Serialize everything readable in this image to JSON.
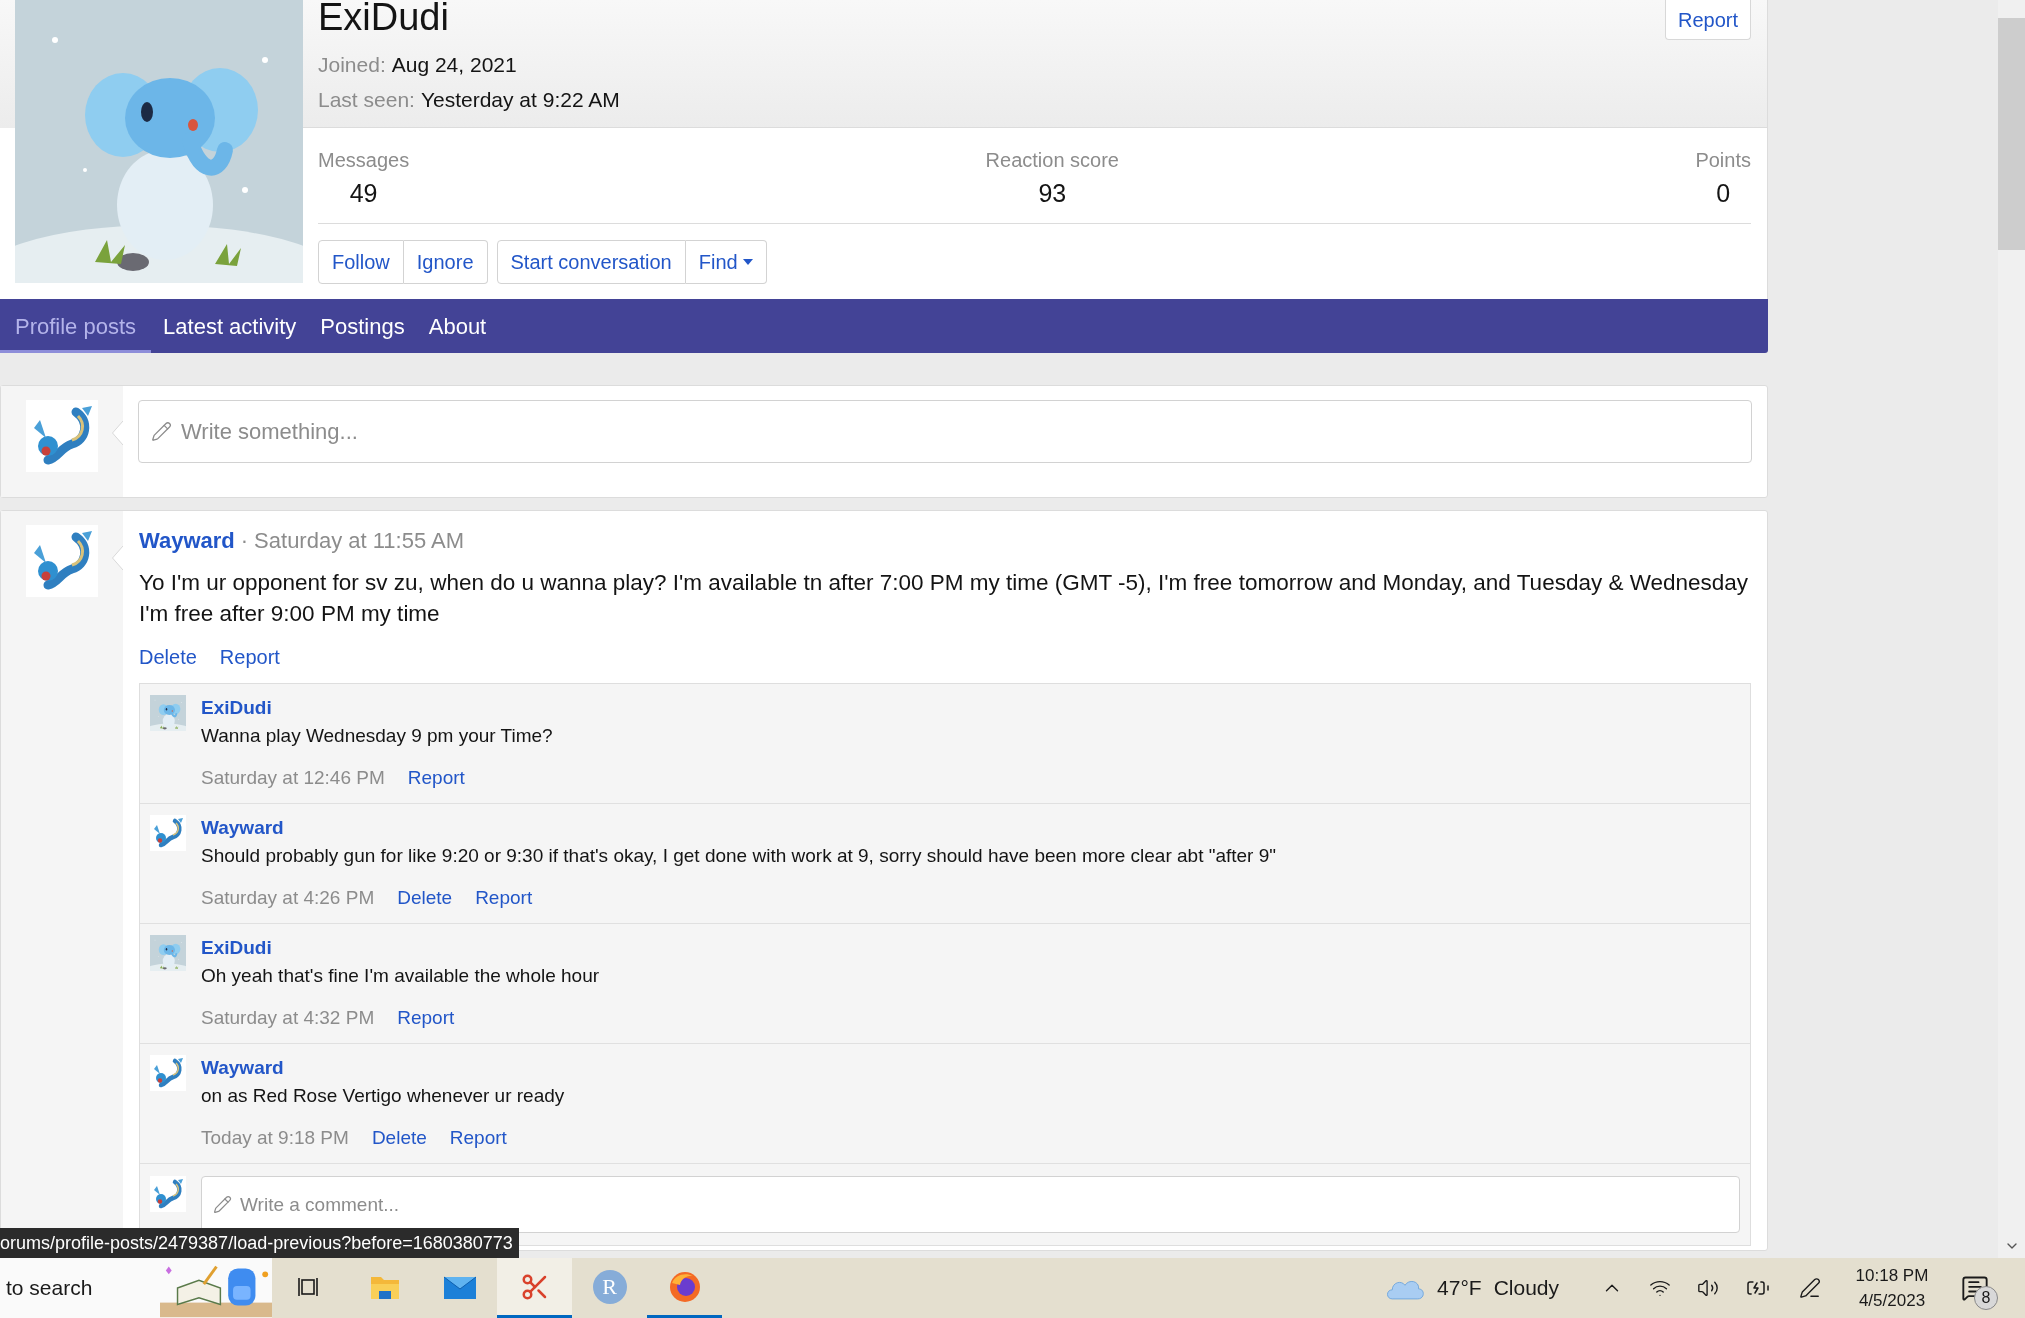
{
  "profile": {
    "name": "ExiDudi",
    "report": "Report",
    "details": [
      {
        "label": "Joined:",
        "value": "Aug 24, 2021"
      },
      {
        "label": "Last seen:",
        "value": "Yesterday at 9:22 AM"
      }
    ]
  },
  "stats": [
    {
      "label": "Messages",
      "value": "49"
    },
    {
      "label": "Reaction score",
      "value": "93"
    },
    {
      "label": "Points",
      "value": "0"
    }
  ],
  "action_groups": [
    [
      {
        "label": "Follow",
        "kind": "button"
      },
      {
        "label": "Ignore",
        "kind": "button"
      }
    ],
    [
      {
        "label": "Start conversation",
        "kind": "button"
      },
      {
        "label": "Find",
        "kind": "menu"
      }
    ]
  ],
  "tabs": [
    {
      "label": "Profile posts",
      "selected": true
    },
    {
      "label": "Latest activity",
      "selected": false
    },
    {
      "label": "Postings",
      "selected": false
    },
    {
      "label": "About",
      "selected": false
    }
  ],
  "composer": {
    "placeholder": "Write something..."
  },
  "post": {
    "author": "Wayward",
    "separator": "·",
    "time": "Saturday at 11:55 AM",
    "body": "Yo I'm ur opponent for sv zu, when do u wanna play? I'm available tn after 7:00 PM my time (GMT -5), I'm free tomorrow and Monday, and Tuesday & Wednesday I'm free after 9:00 PM my time",
    "actions": [
      "Delete",
      "Report"
    ],
    "comments": [
      {
        "kind": "owner",
        "author": "ExiDudi",
        "text": "Wanna play Wednesday 9 pm your Time?",
        "time": "Saturday at 12:46 PM",
        "actions": [
          "Report"
        ]
      },
      {
        "kind": "visitor",
        "author": "Wayward",
        "text": "Should probably gun for like 9:20 or 9:30 if that's okay, I get done with work at 9, sorry should have been more clear abt \"after 9\"",
        "time": "Saturday at 4:26 PM",
        "actions": [
          "Delete",
          "Report"
        ]
      },
      {
        "kind": "owner",
        "author": "ExiDudi",
        "text": "Oh yeah that's fine I'm available the whole hour",
        "time": "Saturday at 4:32 PM",
        "actions": [
          "Report"
        ]
      },
      {
        "kind": "visitor",
        "author": "Wayward",
        "text": "on as Red Rose Vertigo whenever ur ready",
        "time": "Today at 9:18 PM",
        "actions": [
          "Delete",
          "Report"
        ]
      }
    ],
    "comment_box": {
      "placeholder": "Write a comment..."
    }
  },
  "status_url": "orums/profile-posts/2479387/load-previous?before=1680380773",
  "taskbar": {
    "search": {
      "placeholder": "to search"
    },
    "apps": [
      {
        "running": false,
        "focused": false
      },
      {
        "running": false,
        "focused": false
      },
      {
        "running": false,
        "focused": false
      },
      {
        "running": true,
        "focused": true
      },
      {
        "label": "R",
        "running": false,
        "focused": false
      },
      {
        "running": true,
        "focused": false
      }
    ],
    "weather": {
      "temperature": "47°F",
      "condition": "Cloudy"
    },
    "clock": {
      "time": "10:18 PM",
      "date": "4/5/2023"
    },
    "notifications": "8"
  }
}
